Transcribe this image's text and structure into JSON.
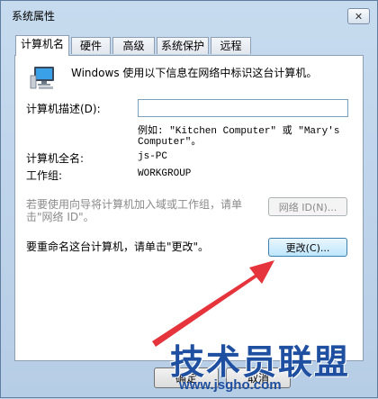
{
  "window": {
    "title": "系统属性",
    "close_glyph": "✕"
  },
  "tabs": [
    {
      "label": "计算机名",
      "active": true
    },
    {
      "label": "硬件",
      "active": false
    },
    {
      "label": "高级",
      "active": false
    },
    {
      "label": "系统保护",
      "active": false
    },
    {
      "label": "远程",
      "active": false
    }
  ],
  "panel": {
    "intro": "Windows 使用以下信息在网络中标识这台计算机。",
    "desc_label": "计算机描述(D):",
    "desc_value": "",
    "example_line1": "例如: \"Kitchen Computer\" 或 \"Mary's",
    "example_line2": "Computer\"。",
    "fullname_label": "计算机全名:",
    "fullname_value": "js-PC",
    "workgroup_label": "工作组:",
    "workgroup_value": "WORKGROUP",
    "wizard_line1": "若要使用向导将计算机加入域或工作组，请单",
    "wizard_line2": "击\"网络 ID\"。",
    "network_id_button": "网络 ID(N)...",
    "rename_text": "要重命名这台计算机，请单击\"更改\"。",
    "change_button": "更改(C)..."
  },
  "footer": {
    "ok_button": "确定",
    "cancel_button": "取消"
  },
  "watermark": {
    "brand": "技术员联盟",
    "url": "www.jsgho.com"
  },
  "colors": {
    "arrow": "#e5343b",
    "watermark": "#1e4fa0"
  }
}
